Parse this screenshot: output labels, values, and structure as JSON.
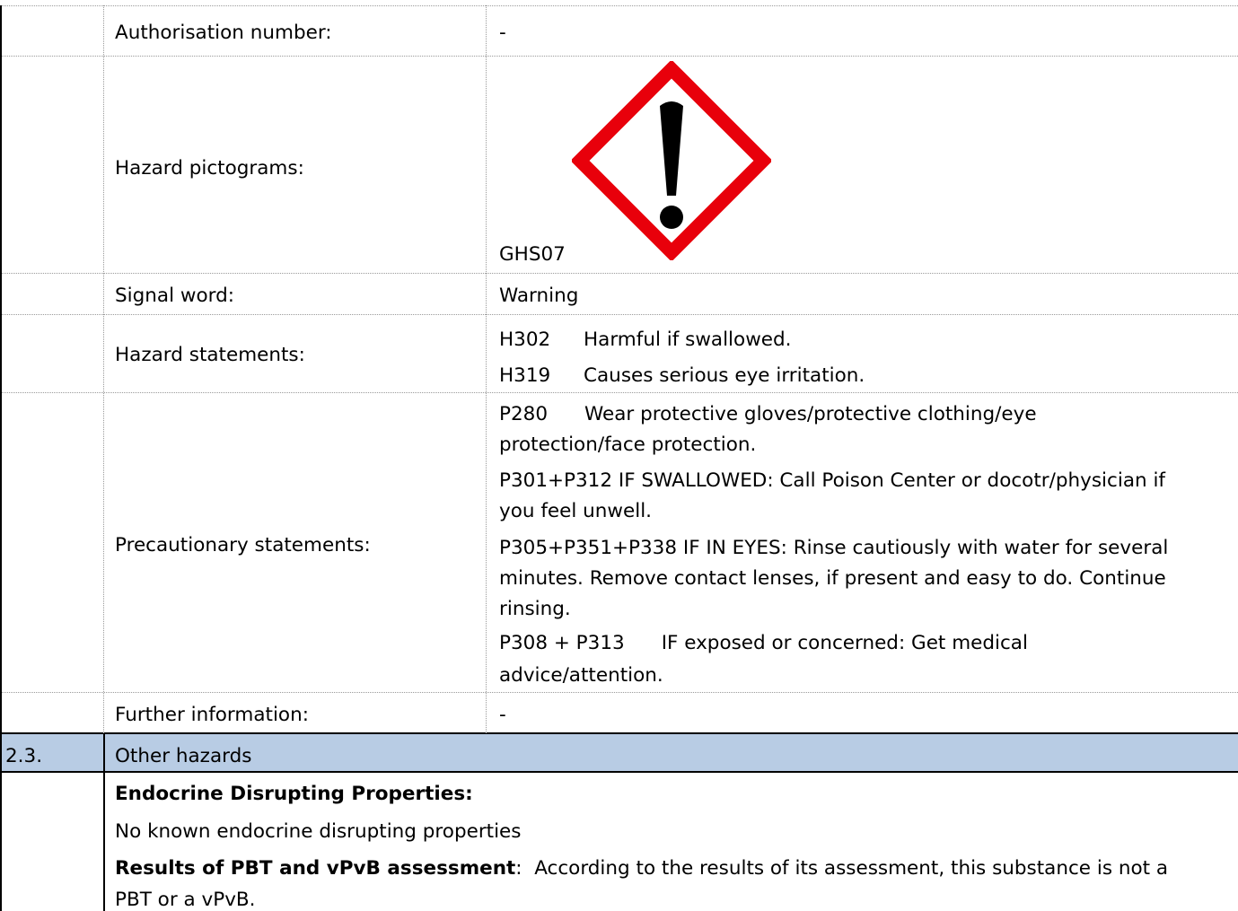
{
  "rows": {
    "authorisation": {
      "label": "Authorisation number:",
      "value": "-"
    },
    "pictograms": {
      "label": "Hazard pictograms:",
      "code": "GHS07",
      "icon": "ghs07-exclamation-icon"
    },
    "signal_word": {
      "label": "Signal word:",
      "value": "Warning"
    },
    "hazard_statements": {
      "label": "Hazard statements:",
      "items": [
        {
          "code": "H302",
          "text": "Harmful if swallowed."
        },
        {
          "code": "H319",
          "text": "Causes serious eye irritation."
        }
      ]
    },
    "precautionary": {
      "label": "Precautionary statements:",
      "lines": [
        "P280      Wear protective gloves/protective clothing/eye",
        "protection/face protection.",
        "P301+P312 IF SWALLOWED: Call Poison Center or docotr/physician if",
        "you feel unwell.",
        "P305+P351+P338 IF IN EYES: Rinse cautiously with water for several",
        "minutes. Remove contact lenses, if present and easy to do. Continue",
        "rinsing.",
        "P308 + P313      IF exposed or concerned: Get medical",
        "advice/attention."
      ]
    },
    "further_info": {
      "label": "Further information:",
      "value": "-"
    }
  },
  "section_2_3": {
    "number": "2.3.",
    "title": "Other hazards",
    "endocrine_heading": "Endocrine Disrupting Properties:",
    "endocrine_text": "No known endocrine disrupting properties",
    "pbt_heading": "Results of PBT and vPvB assessment",
    "pbt_text": ":  According to the results of its assessment, this substance is not a",
    "pbt_text_2": "PBT or a vPvB."
  },
  "colors": {
    "section_band": "#b8cce4",
    "pictogram_border": "#e8000b"
  }
}
